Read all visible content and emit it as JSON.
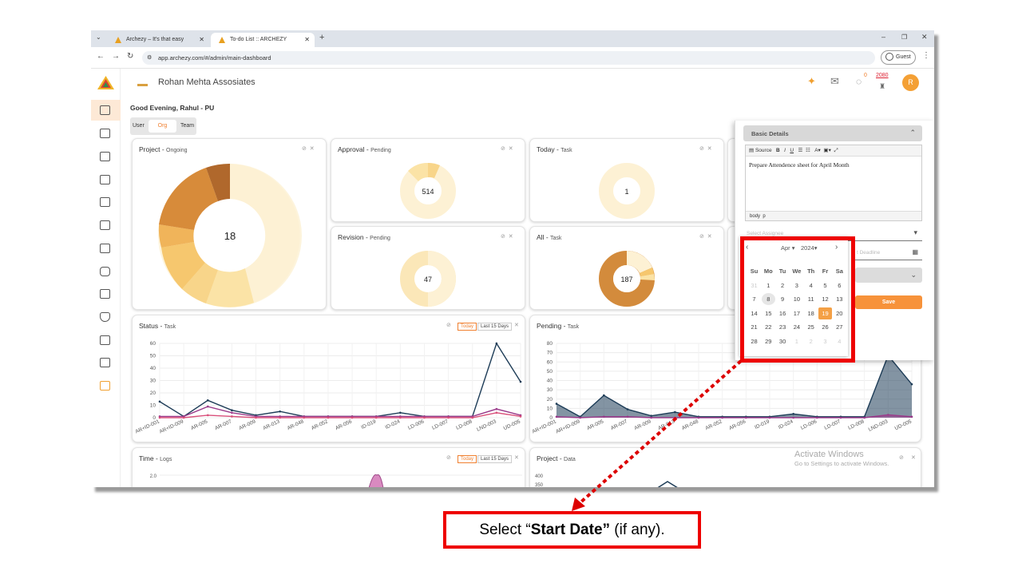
{
  "browser": {
    "tabs": [
      {
        "label": "Archezy – It's that easy",
        "active": false
      },
      {
        "label": "To-do List :: ARCHEZY",
        "active": true
      }
    ],
    "url": "app.archezy.com/#/admin/main-dashboard",
    "profile": "Guest"
  },
  "app": {
    "logo_text": "ARCHEZY",
    "company": "Rohan Mehta Assosiates",
    "greeting": "Good Evening, Rahul - PU",
    "toggle": [
      "User",
      "Org",
      "Team"
    ],
    "toggle_selected": "Org",
    "badge_notifications": "0",
    "badge_points": "2080",
    "avatar": "R"
  },
  "cards": {
    "project": {
      "title": "Project",
      "sub": "Ongoing",
      "center": "18"
    },
    "approval": {
      "title": "Approval",
      "sub": "Pending",
      "center": "514"
    },
    "today": {
      "title": "Today",
      "sub": "Task",
      "center": "1"
    },
    "revision": {
      "title": "Revision",
      "sub": "Pending",
      "center": "47"
    },
    "all": {
      "title": "All",
      "sub": "Task",
      "center": "187"
    },
    "status": {
      "title": "Status",
      "sub": "Task",
      "btn_today": "Today",
      "btn_15": "Last 15 Days"
    },
    "pending": {
      "title": "Pending",
      "sub": "Task"
    },
    "time": {
      "title": "Time",
      "sub": "Logs",
      "btn_today": "Today",
      "btn_15": "Last 15 Days"
    },
    "projdata": {
      "title": "Project",
      "sub": "Data"
    }
  },
  "chart_data": [
    {
      "type": "line",
      "title": "Status - Task",
      "categories": [
        "AR+ID-001",
        "AR+ID-009",
        "AR-005",
        "AR-007",
        "AR-009",
        "AR-013",
        "AR-048",
        "AR-052",
        "AR-056",
        "ID-019",
        "ID-024",
        "LD-006",
        "LD-007",
        "LD-008",
        "LND-003",
        "UD-005"
      ],
      "ylim": [
        0,
        60
      ],
      "yticks": [
        "0",
        "10",
        "20",
        "30",
        "40",
        "50",
        "60"
      ],
      "series": [
        {
          "color": "#1d3c57",
          "values": [
            13,
            1,
            14,
            6,
            2,
            5,
            1,
            1,
            1,
            1,
            4,
            1,
            1,
            1,
            60,
            29
          ]
        },
        {
          "color": "#9a3a8a",
          "values": [
            1,
            1,
            9,
            4,
            1,
            1,
            1,
            1,
            1,
            1,
            1,
            1,
            1,
            1,
            7,
            2
          ]
        },
        {
          "color": "#d94f7a",
          "values": [
            0,
            0,
            2,
            1,
            0,
            0,
            0,
            0,
            0,
            0,
            0,
            0,
            0,
            0,
            4,
            1
          ]
        }
      ]
    },
    {
      "type": "area",
      "title": "Pending - Task",
      "categories": [
        "AR+ID-001",
        "AR+ID-009",
        "AR-005",
        "AR-007",
        "AR-009",
        "AR-013",
        "AR-048",
        "AR-052",
        "AR-056",
        "ID-019",
        "ID-024",
        "LD-006",
        "LD-007",
        "LD-008",
        "LND-003",
        "UD-005"
      ],
      "ylim": [
        0,
        80
      ],
      "yticks": [
        "0",
        "10",
        "20",
        "30",
        "40",
        "50",
        "60",
        "70",
        "80"
      ],
      "series": [
        {
          "color": "#1d3c57",
          "values": [
            15,
            1,
            24,
            9,
            2,
            6,
            1,
            1,
            1,
            1,
            4,
            1,
            1,
            1,
            67,
            36
          ]
        },
        {
          "color": "#9a3a8a",
          "values": [
            1,
            0,
            1,
            1,
            0,
            0,
            0,
            0,
            0,
            0,
            0,
            0,
            0,
            0,
            3,
            1
          ]
        }
      ]
    }
  ],
  "panel": {
    "section": "Basic Details",
    "toolbar": [
      "Source",
      "B",
      "I",
      "U"
    ],
    "editor_text": "Prepare Attendence sheet for April Month",
    "status_path": "body  p",
    "assignee_placeholder": "Select Assignee",
    "deadline_placeholder": "t Deadline",
    "save": "Save"
  },
  "calendar": {
    "month": "Apr",
    "year": "2024",
    "weekdays": [
      "Su",
      "Mo",
      "Tu",
      "We",
      "Th",
      "Fr",
      "Sa"
    ],
    "weeks": [
      [
        "31",
        "1",
        "2",
        "3",
        "4",
        "5",
        "6"
      ],
      [
        "7",
        "8",
        "9",
        "10",
        "11",
        "12",
        "13"
      ],
      [
        "14",
        "15",
        "16",
        "17",
        "18",
        "19",
        "20"
      ],
      [
        "21",
        "22",
        "23",
        "24",
        "25",
        "26",
        "27"
      ],
      [
        "28",
        "29",
        "30",
        "1",
        "2",
        "3",
        "4"
      ]
    ],
    "today": "8",
    "selected": "19"
  },
  "watermark": {
    "line1": "Activate Windows",
    "line2": "Go to Settings to activate Windows."
  },
  "caption": {
    "pre": "Select “",
    "bold": "Start Date”",
    "post": " (if any)."
  }
}
